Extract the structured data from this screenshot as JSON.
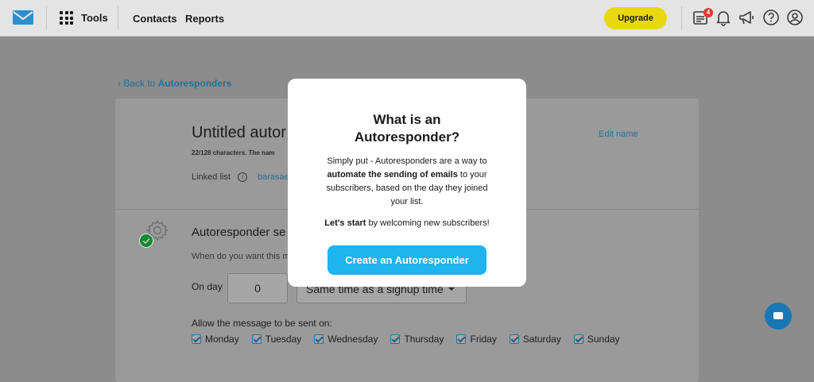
{
  "nav": {
    "tools_label": "Tools",
    "contacts_label": "Contacts",
    "reports_label": "Reports",
    "upgrade_label": "Upgrade",
    "notification_count": "4"
  },
  "page": {
    "back_prefix": "‹ Back to ",
    "back_target": "Autoresponders",
    "title": "Untitled autor",
    "char_count": "22/128 characters. The nam",
    "edit_name": "Edit name",
    "linked_list_label": "Linked list",
    "linked_list_value": "barasae",
    "settings_title": "Autoresponder se",
    "settings_question": "When do you want this m",
    "on_day_label": "On day",
    "on_day_value": "0",
    "time_select_value": "Same time as a signup time",
    "allow_label": "Allow the message to be sent on:",
    "days": [
      "Monday",
      "Tuesday",
      "Wednesday",
      "Thursday",
      "Friday",
      "Saturday",
      "Sunday"
    ]
  },
  "modal": {
    "title_line1_a": "What",
    "title_line1_b": " is an",
    "title_line2": "Autoresponder?",
    "body_pre": "Simply put - Autoresponders are a way to ",
    "body_bold": "automate the sending of emails",
    "body_post": " to your subscribers, based on the day they joined your list.",
    "start_bold": "Let's start",
    "start_rest": " by welcoming new subscribers!",
    "button_label": "Create an Autoresponder"
  },
  "colors": {
    "accent": "#1db4ef",
    "upgrade": "#e8d90f",
    "badge": "#e53a2f",
    "link": "#256f98"
  },
  "icons": {
    "logo": "envelope-logo-icon",
    "tools": "grid-icon",
    "top_right": [
      "newsletter-icon",
      "bell-icon",
      "megaphone-icon",
      "help-icon",
      "account-icon"
    ],
    "settings": "gear-icon",
    "chat": "chat-icon"
  }
}
